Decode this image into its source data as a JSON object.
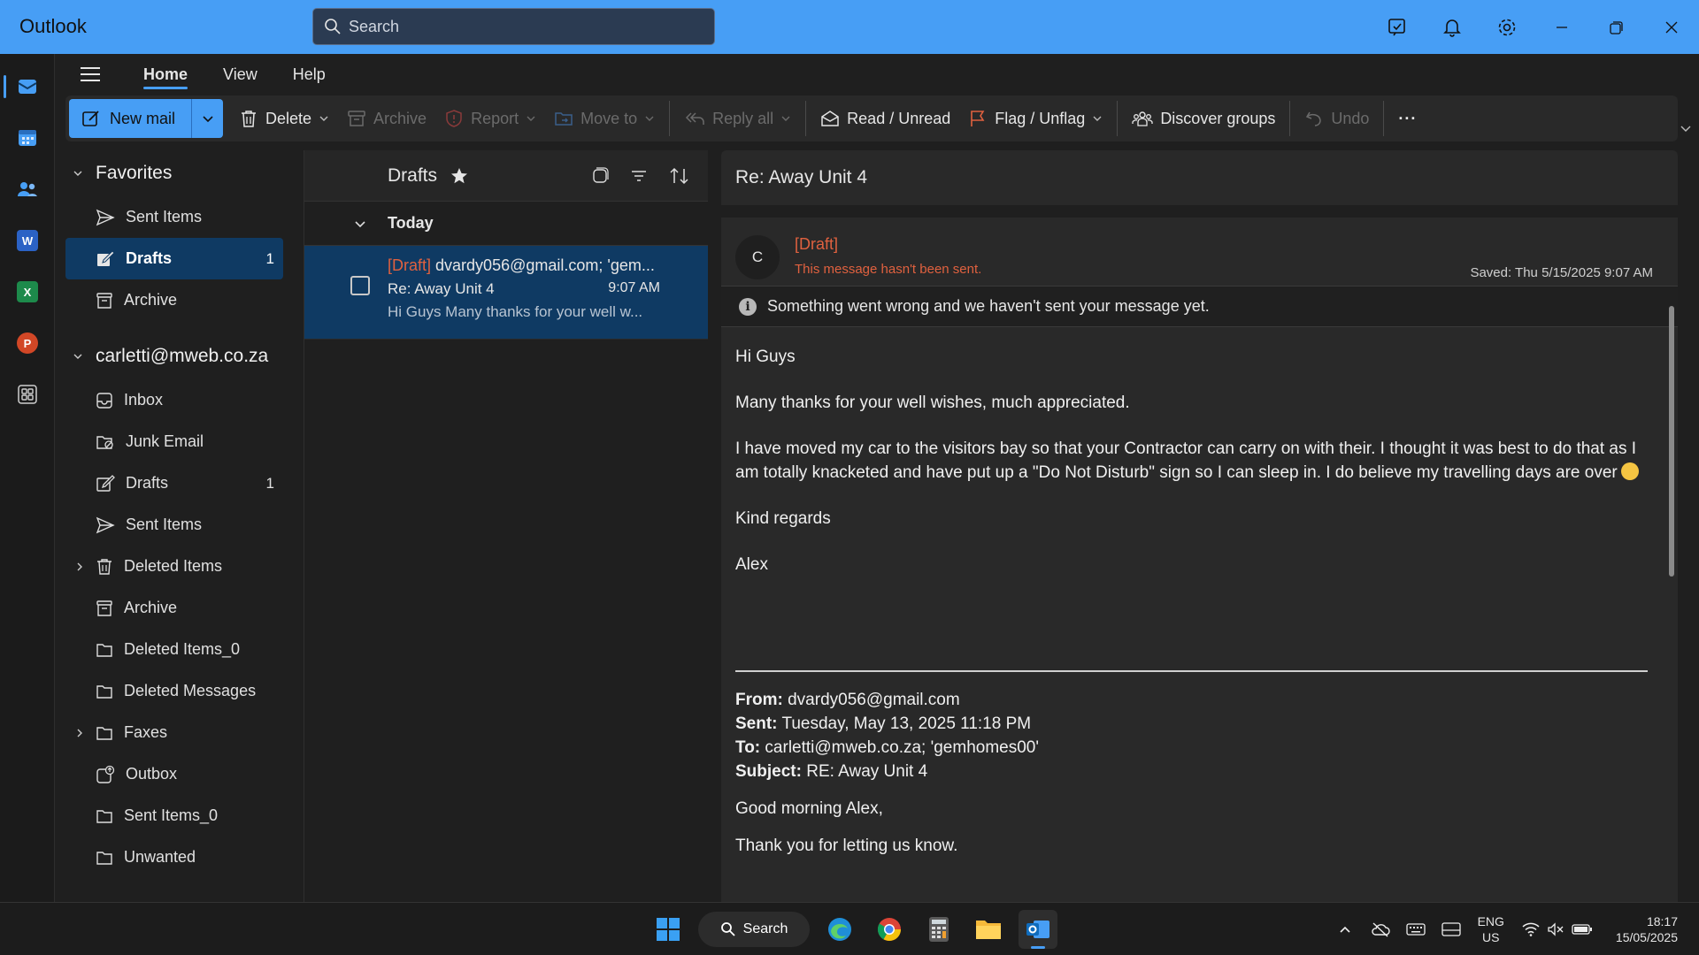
{
  "app": {
    "title": "Outlook"
  },
  "search": {
    "placeholder": "Search"
  },
  "tabs": [
    {
      "label": "Home",
      "active": true
    },
    {
      "label": "View",
      "active": false
    },
    {
      "label": "Help",
      "active": false
    }
  ],
  "ribbon": {
    "new_mail": "New mail",
    "delete": "Delete",
    "archive": "Archive",
    "report": "Report",
    "move_to": "Move to",
    "reply_all": "Reply all",
    "read_unread": "Read / Unread",
    "flag_unflag": "Flag / Unflag",
    "discover_groups": "Discover groups",
    "undo": "Undo",
    "more": "···"
  },
  "folders": {
    "favorites": {
      "label": "Favorites",
      "items": [
        {
          "label": "Sent Items",
          "icon": "send-icon",
          "count": ""
        },
        {
          "label": "Drafts",
          "icon": "draft-icon",
          "count": "1",
          "selected": true
        },
        {
          "label": "Archive",
          "icon": "archive-icon",
          "count": ""
        }
      ]
    },
    "account": {
      "label": "carletti@mweb.co.za",
      "items": [
        {
          "label": "Inbox",
          "icon": "inbox-icon",
          "count": ""
        },
        {
          "label": "Junk Email",
          "icon": "junk-icon",
          "count": ""
        },
        {
          "label": "Drafts",
          "icon": "draft-icon",
          "count": "1"
        },
        {
          "label": "Sent Items",
          "icon": "send-icon",
          "count": ""
        },
        {
          "label": "Deleted Items",
          "icon": "trash-icon",
          "count": "",
          "expandable": true
        },
        {
          "label": "Archive",
          "icon": "archive-icon",
          "count": ""
        },
        {
          "label": "Deleted Items_0",
          "icon": "folder-icon",
          "count": ""
        },
        {
          "label": "Deleted Messages",
          "icon": "folder-icon",
          "count": ""
        },
        {
          "label": "Faxes",
          "icon": "folder-icon",
          "count": "",
          "expandable": true
        },
        {
          "label": "Outbox",
          "icon": "outbox-icon",
          "count": ""
        },
        {
          "label": "Sent Items_0",
          "icon": "folder-icon",
          "count": ""
        },
        {
          "label": "Unwanted",
          "icon": "folder-icon",
          "count": ""
        }
      ]
    }
  },
  "list": {
    "title": "Drafts",
    "group": "Today",
    "messages": [
      {
        "draft_tag": "[Draft]",
        "to": "dvardy056@gmail.com; 'gem...",
        "subject": "Re: Away Unit 4",
        "time": "9:07 AM",
        "preview": "Hi Guys Many thanks for your well w..."
      }
    ]
  },
  "reader": {
    "subject": "Re: Away Unit 4",
    "avatar": "C",
    "draft_tag": "[Draft]",
    "unsent_note": "This message hasn't been sent.",
    "saved": "Saved: Thu 5/15/2025 9:07 AM",
    "warning": "Something went wrong and we haven't sent your message yet.",
    "body": {
      "greeting": "Hi Guys",
      "p1": "Many thanks for your well wishes, much appreciated.",
      "p2": "I have moved my car to the visitors bay so that your Contractor can carry on with their. I thought it was best to do that as I am totally knacketed and have put up a \"Do Not Disturb\" sign so I can sleep in. I do believe my travelling days are over",
      "closing": "Kind regards",
      "signature": "Alex"
    },
    "quoted": {
      "from_label": "From:",
      "from": "dvardy056@gmail.com",
      "sent_label": "Sent:",
      "sent": "Tuesday, May 13, 2025 11:18 PM",
      "to_label": "To:",
      "to": "carletti@mweb.co.za; 'gemhomes00'",
      "subject_label": "Subject:",
      "subject": "RE: Away Unit 4",
      "line1": "Good morning Alex,",
      "line2": "Thank you for letting us know."
    }
  },
  "taskbar": {
    "search": "Search",
    "lang_top": "ENG",
    "lang_bottom": "US",
    "time": "18:17",
    "date": "15/05/2025"
  },
  "colors": {
    "accent": "#479ef5",
    "selected": "#0f3a63",
    "draft": "#e0613f"
  }
}
